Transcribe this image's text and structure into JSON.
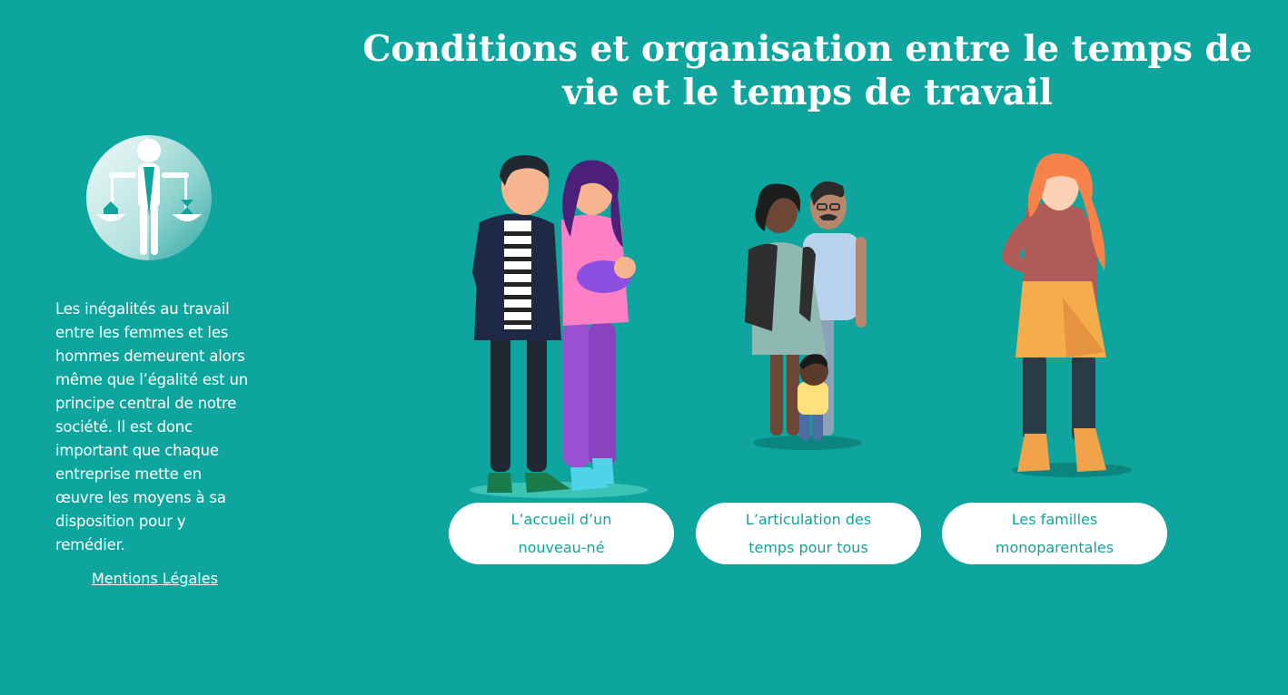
{
  "page": {
    "title": "Conditions et organisation entre le temps de vie et le temps de travail"
  },
  "sidebar": {
    "logo_icon": "balance-person-icon",
    "intro_text": "Les inégalités au travail entre les femmes et les hommes demeurent alors même que l’égalité est un principe central de notre société. Il est donc important que chaque entreprise mette en œuvre les moyens à sa disposition pour y remédier.",
    "legal_link": "Mentions Légales"
  },
  "cards": [
    {
      "label": "L’accueil d’un nouveau-né",
      "illustration": "couple-with-baby"
    },
    {
      "label": "L’articulation des temps pour tous",
      "illustration": "family-with-child"
    },
    {
      "label": "Les familles monoparentales",
      "illustration": "single-woman"
    }
  ],
  "colors": {
    "background": "#0ea59e",
    "button_bg": "#ffffff",
    "button_text": "#12a39b"
  }
}
